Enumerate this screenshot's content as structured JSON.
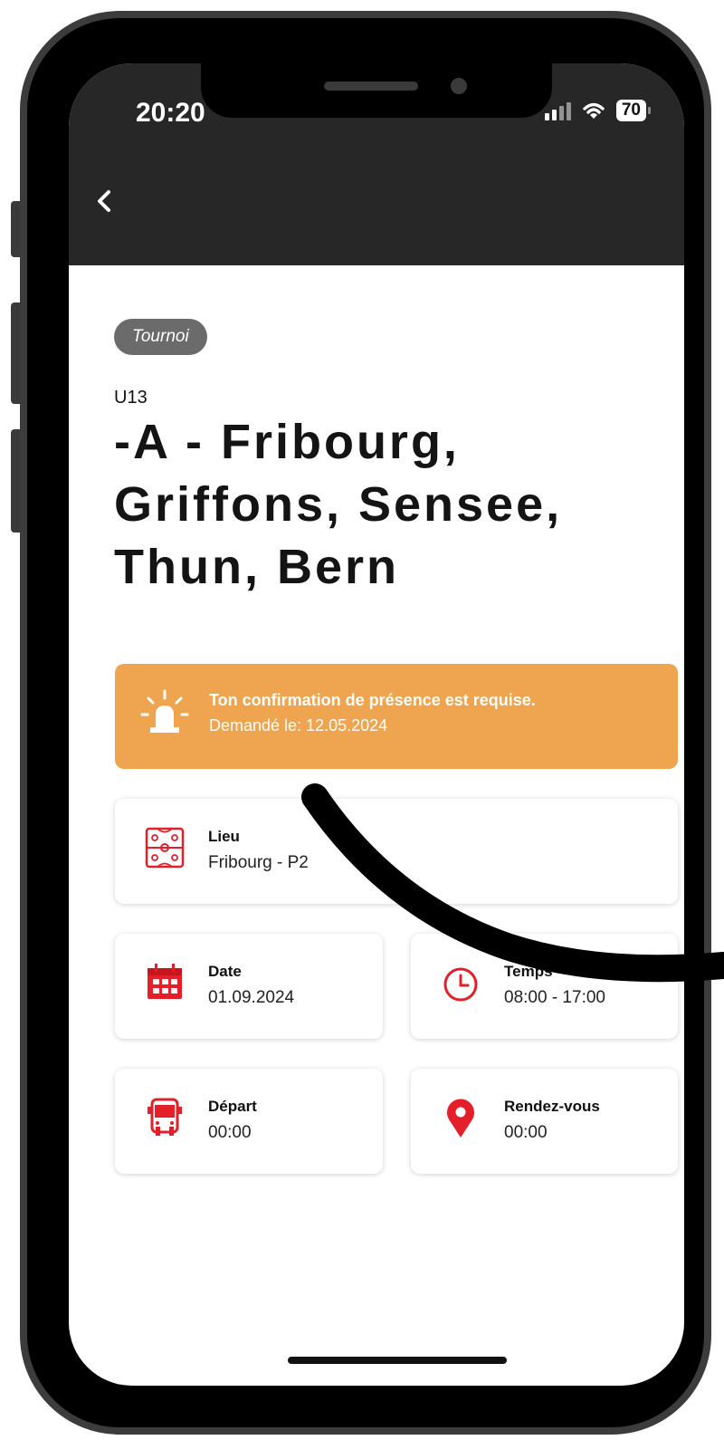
{
  "status_bar": {
    "time": "20:20",
    "battery": "70",
    "icons": [
      "signal-icon",
      "wifi-icon",
      "battery-icon"
    ]
  },
  "nav": {
    "back_icon": "chevron-left-icon"
  },
  "event": {
    "badge": "Tournoi",
    "category": "U13",
    "title": "-A - Fribourg, Griffons, Sensee, Thun, Bern"
  },
  "alert": {
    "icon": "siren-icon",
    "line1": "Ton confirmation de présence est requise.",
    "line2": "Demandé le: 12.05.2024",
    "color": "#efa44f"
  },
  "details": {
    "lieu": {
      "label": "Lieu",
      "value": "Fribourg - P2",
      "icon": "field-icon"
    },
    "date": {
      "label": "Date",
      "value": "01.09.2024",
      "icon": "calendar-icon"
    },
    "temps": {
      "label": "Temps",
      "value": "08:00 - 17:00",
      "icon": "clock-icon"
    },
    "depart": {
      "label": "Départ",
      "value": "00:00",
      "icon": "bus-icon"
    },
    "rendez_vous": {
      "label": "Rendez-vous",
      "value": "00:00",
      "icon": "location-pin-icon"
    }
  },
  "colors": {
    "accent_red": "#e3202a",
    "header": "#272727",
    "badge": "#6b6b6b"
  }
}
